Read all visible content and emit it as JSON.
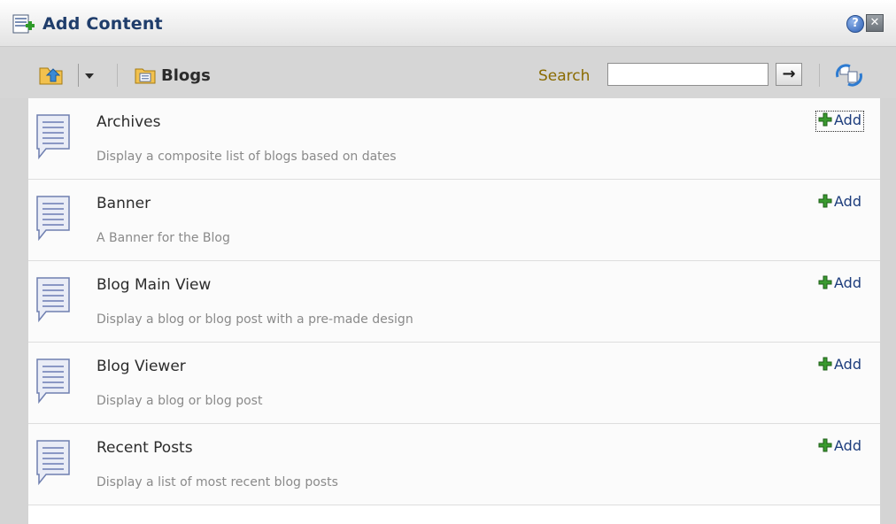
{
  "header": {
    "title": "Add Content",
    "help_label": "?",
    "close_label": "✕"
  },
  "toolbar": {
    "folder_name": "Blogs",
    "search_label": "Search",
    "search_value": "",
    "go_label": "→"
  },
  "items": [
    {
      "name": "Archives",
      "description": "Display a composite list of blogs based on dates",
      "add_label": "Add"
    },
    {
      "name": "Banner",
      "description": "A Banner for the Blog",
      "add_label": "Add"
    },
    {
      "name": "Blog Main View",
      "description": "Display a blog or blog post with a pre-made design",
      "add_label": "Add"
    },
    {
      "name": "Blog Viewer",
      "description": "Display a blog or blog post",
      "add_label": "Add"
    },
    {
      "name": "Recent Posts",
      "description": "Display a list of most recent blog posts",
      "add_label": "Add"
    }
  ],
  "colors": {
    "title": "#1f3d6b",
    "search_label": "#8a6b00",
    "add_link": "#1c3c7c"
  }
}
